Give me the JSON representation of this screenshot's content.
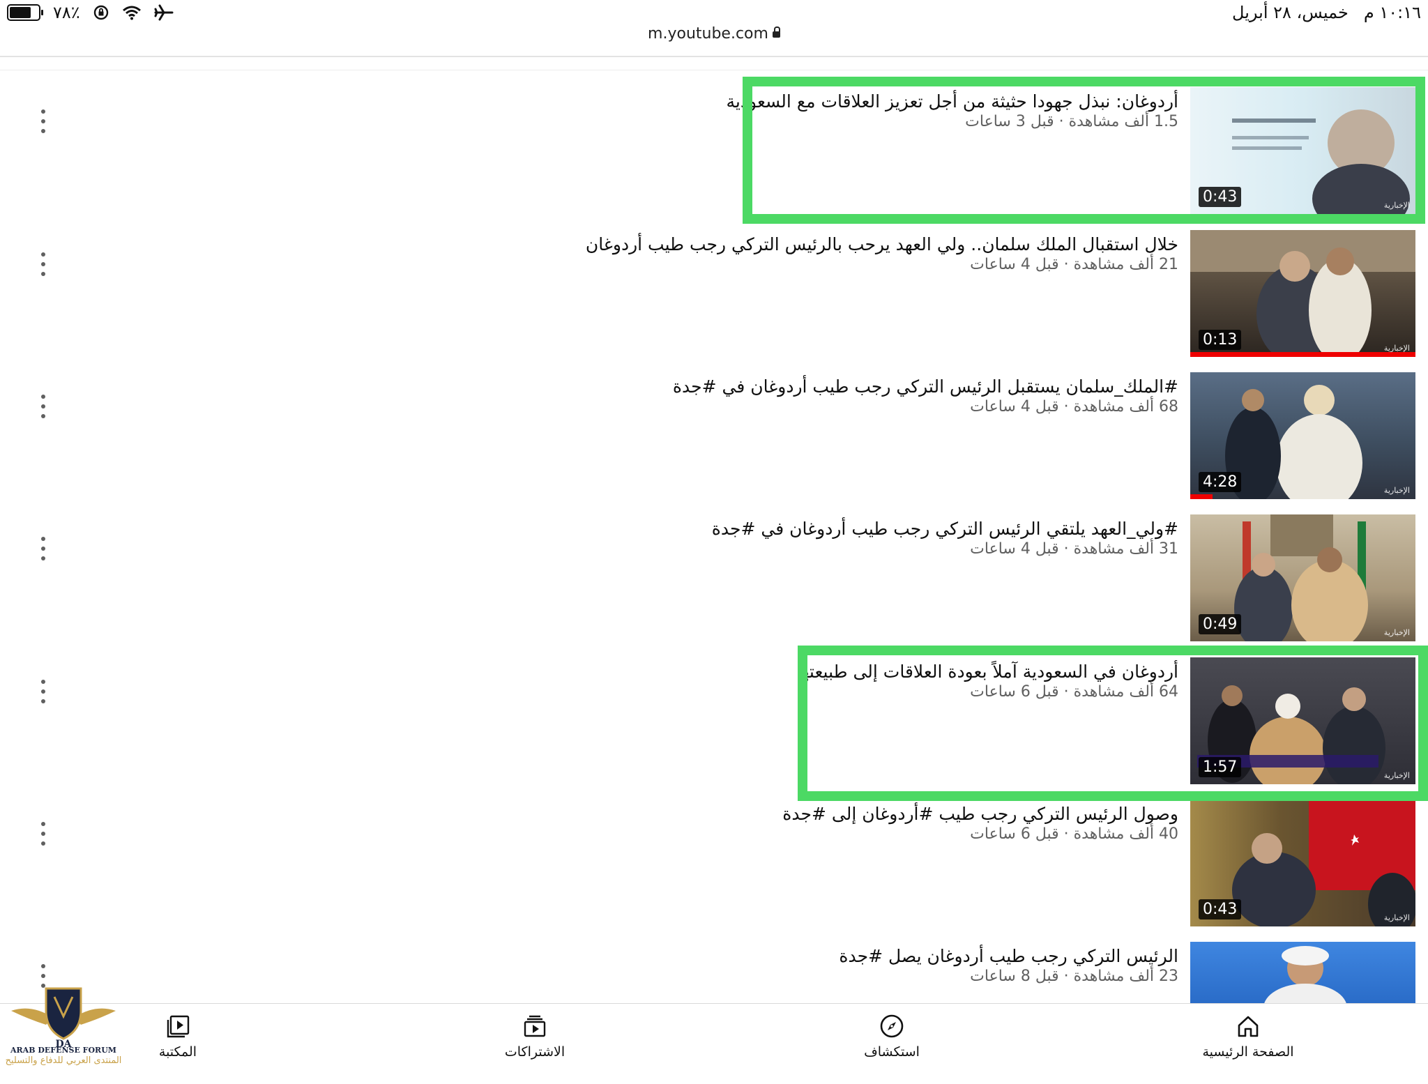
{
  "status_bar": {
    "battery": "٧٨٪",
    "time": "١٠:١٦ م",
    "date": "خميس، ٢٨ أبريل"
  },
  "browser": {
    "url": "m.youtube.com"
  },
  "videos": [
    {
      "title": "أردوغان: نبذل جهودا حثيثة من أجل تعزيز العلاقات مع السعودية",
      "meta": "1.5 ألف مشاهدة · قبل 3 ساعات",
      "duration": "0:43",
      "progress": 0,
      "thumb_label": "الإخبارية",
      "highlighted": true
    },
    {
      "title": "خلال استقبال الملك سلمان.. ولي العهد يرحب بالرئيس التركي رجب طيب أردوغان",
      "meta": "21 ألف مشاهدة · قبل 4 ساعات",
      "duration": "0:13",
      "progress": 1.0,
      "thumb_label": "الإخبارية",
      "highlighted": false
    },
    {
      "title": "#الملك_سلمان يستقبل الرئيس التركي رجب طيب أردوغان في #جدة",
      "meta": "68 ألف مشاهدة · قبل 4 ساعات",
      "duration": "4:28",
      "progress": 0.1,
      "thumb_label": "الإخبارية",
      "highlighted": false
    },
    {
      "title": "#ولي_العهد يلتقي الرئيس التركي رجب طيب أردوغان في #جدة",
      "meta": "31 ألف مشاهدة · قبل 4 ساعات",
      "duration": "0:49",
      "progress": 0,
      "thumb_label": "الإخبارية",
      "highlighted": false
    },
    {
      "title": "أردوغان في السعودية آملاً بعودة العلاقات إلى طبيعتها",
      "meta": "64 ألف مشاهدة · قبل 6 ساعات",
      "duration": "1:57",
      "progress": 0,
      "thumb_label": "الإخبارية",
      "highlighted": true
    },
    {
      "title": "وصول الرئيس التركي رجب طيب #أردوغان إلى #جدة",
      "meta": "40 ألف مشاهدة · قبل 6 ساعات",
      "duration": "0:43",
      "progress": 0,
      "thumb_label": "الإخبارية",
      "highlighted": false
    },
    {
      "title": "الرئيس التركي رجب طيب أردوغان يصل #جدة",
      "meta": "23 ألف مشاهدة · قبل 8 ساعات",
      "duration": "",
      "progress": 0,
      "thumb_label": "",
      "highlighted": false
    }
  ],
  "nav": {
    "home": "الصفحة الرئيسية",
    "explore": "استكشاف",
    "subscriptions": "الاشتراكات",
    "library": "المكتبة"
  },
  "watermark": {
    "en": "ARAB DEFENSE FORUM",
    "ar": "المنتدى العربي للدفاع والتسليح"
  },
  "colors": {
    "highlight": "#4cd964",
    "progress": "#e00000"
  }
}
